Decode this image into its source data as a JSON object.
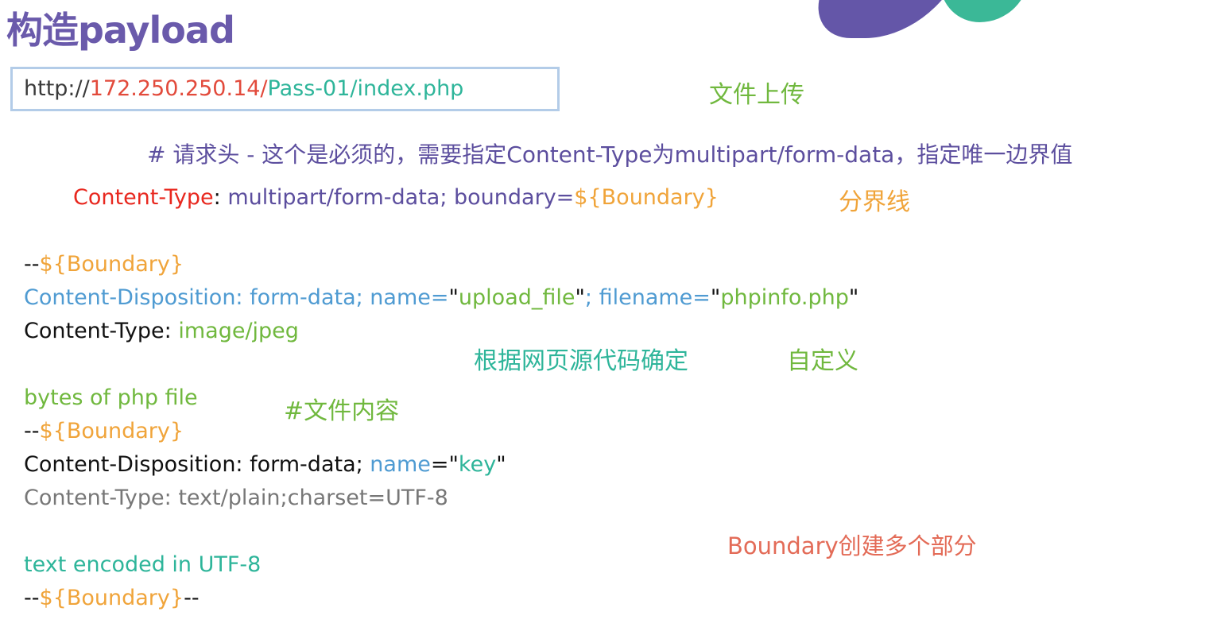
{
  "title": "构造payload",
  "url": {
    "scheme": "http://",
    "host": "172.250.250.14/",
    "path": "Pass-01/index.php"
  },
  "notes": {
    "file_upload": "文件上传",
    "header_comment": "# 请求头 - 这个是必须的，需要指定Content-Type为multipart/form-data，指定唯一边界值",
    "boundary_line": "分界线",
    "from_source": "根据网页源代码确定",
    "custom": "自定义",
    "file_content": "#文件内容",
    "multi_part": "Boundary创建多个部分"
  },
  "header_line": {
    "key": "Content-Type",
    "sep": ":",
    "value": " multipart/form-data; boundary=",
    "var": "${Boundary}"
  },
  "body": {
    "boundary_prefix": "--",
    "boundary_var": "${Boundary}",
    "boundary_suffix": "--",
    "disp1_prefix": "Content-Disposition: form-data; name=",
    "quote": "\"",
    "upload_field": "upload_file",
    "disp1_mid": "; filename=",
    "filename": "phpinfo.php",
    "ctype_key": "Content-Type: ",
    "ctype_val": "image/jpeg",
    "file_bytes": "bytes of php file",
    "disp2_prefix": "Content-Disposition: form-data; ",
    "disp2_name": "name",
    "disp2_eq": "=",
    "key_field": "key",
    "ctype_text": "Content-Type: text/plain;charset=UTF-8",
    "text_encoded": "text encoded in UTF-8"
  },
  "colors": {
    "title": "#6a5aab",
    "accent_purple": "#6456a8",
    "accent_green": "#3bb897",
    "url_border": "#b3cce8"
  }
}
